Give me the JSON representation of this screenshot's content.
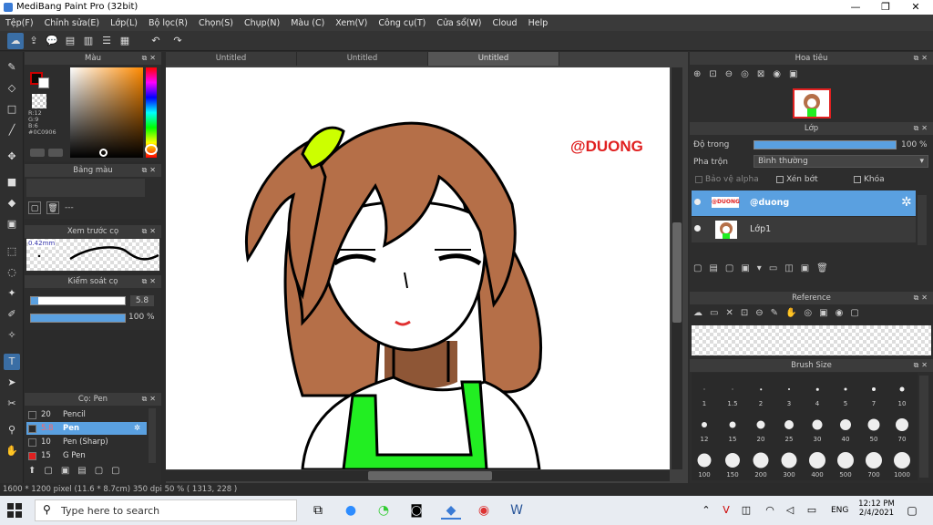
{
  "window": {
    "title": "MediBang Paint Pro (32bit)",
    "minimize": "—",
    "maximize": "❐",
    "close": "✕"
  },
  "menu": [
    "Tệp(F)",
    "Chỉnh sửa(E)",
    "Lớp(L)",
    "Bộ lọc(R)",
    "Chọn(S)",
    "Chụp(N)",
    "Màu (C)",
    "Xem(V)",
    "Công cụ(T)",
    "Cửa sổ(W)",
    "Cloud",
    "Help"
  ],
  "tabs": [
    "Untitled",
    "Untitled",
    "Untitled"
  ],
  "color_panel": {
    "title": "Màu",
    "r": "R:12",
    "g": "G:9",
    "b": "B:6",
    "hex": "#0C0906",
    "primary": "#0C0906"
  },
  "palette_panel": {
    "title": "Bảng màu",
    "value": "---"
  },
  "brush_preview": {
    "title": "Xem trước cọ",
    "size": "0.42mm"
  },
  "brush_control": {
    "title": "Kiểm soát cọ",
    "size": "5.8",
    "opacity": "100 %"
  },
  "brush_list": {
    "title": "Cọ: Pen",
    "items": [
      {
        "size": "20",
        "name": "Pencil",
        "color": "#2b2b2b",
        "active": false
      },
      {
        "size": "5.8",
        "name": "Pen",
        "color": "#2b2b2b",
        "active": true
      },
      {
        "size": "10",
        "name": "Pen (Sharp)",
        "color": "#2b2b2b",
        "active": false
      },
      {
        "size": "15",
        "name": "G Pen",
        "color": "#e02020",
        "active": false
      }
    ]
  },
  "canvas": {
    "watermark": "@DUONG"
  },
  "navigator": {
    "title": "Hoa tiêu"
  },
  "layer_panel": {
    "title": "Lớp",
    "opacity_label": "Độ trong",
    "opacity_value": "100 %",
    "blend_label": "Pha trộn",
    "blend_value": "Bình thường",
    "protect_alpha": "Bảo vệ alpha",
    "clipping": "Xén bớt",
    "lock": "Khóa",
    "layers": [
      {
        "name": "@duong",
        "thumb": "@DUONG",
        "active": true
      },
      {
        "name": "Lớp1",
        "active": false
      }
    ]
  },
  "reference_panel": {
    "title": "Reference"
  },
  "brush_size_panel": {
    "title": "Brush Size",
    "sizes": [
      "1",
      "1.5",
      "2",
      "3",
      "4",
      "5",
      "7",
      "10",
      "12",
      "15",
      "20",
      "25",
      "30",
      "40",
      "50",
      "70",
      "100",
      "150",
      "200",
      "300",
      "400",
      "500",
      "700",
      "1000"
    ],
    "dots": [
      1,
      1,
      1.5,
      2,
      2.5,
      3,
      4,
      5,
      6,
      7,
      9,
      10,
      11,
      12,
      13,
      14,
      15,
      16,
      17,
      17,
      18,
      18,
      18,
      18
    ]
  },
  "status": {
    "text": "1600 * 1200 pixel   (11.6 * 8.7cm)   350 dpi   50 %   ( 1313, 228 )"
  },
  "taskbar": {
    "search_placeholder": "Type here to search",
    "time": "12:12 PM",
    "date": "2/4/2021",
    "lang": "ENG"
  }
}
